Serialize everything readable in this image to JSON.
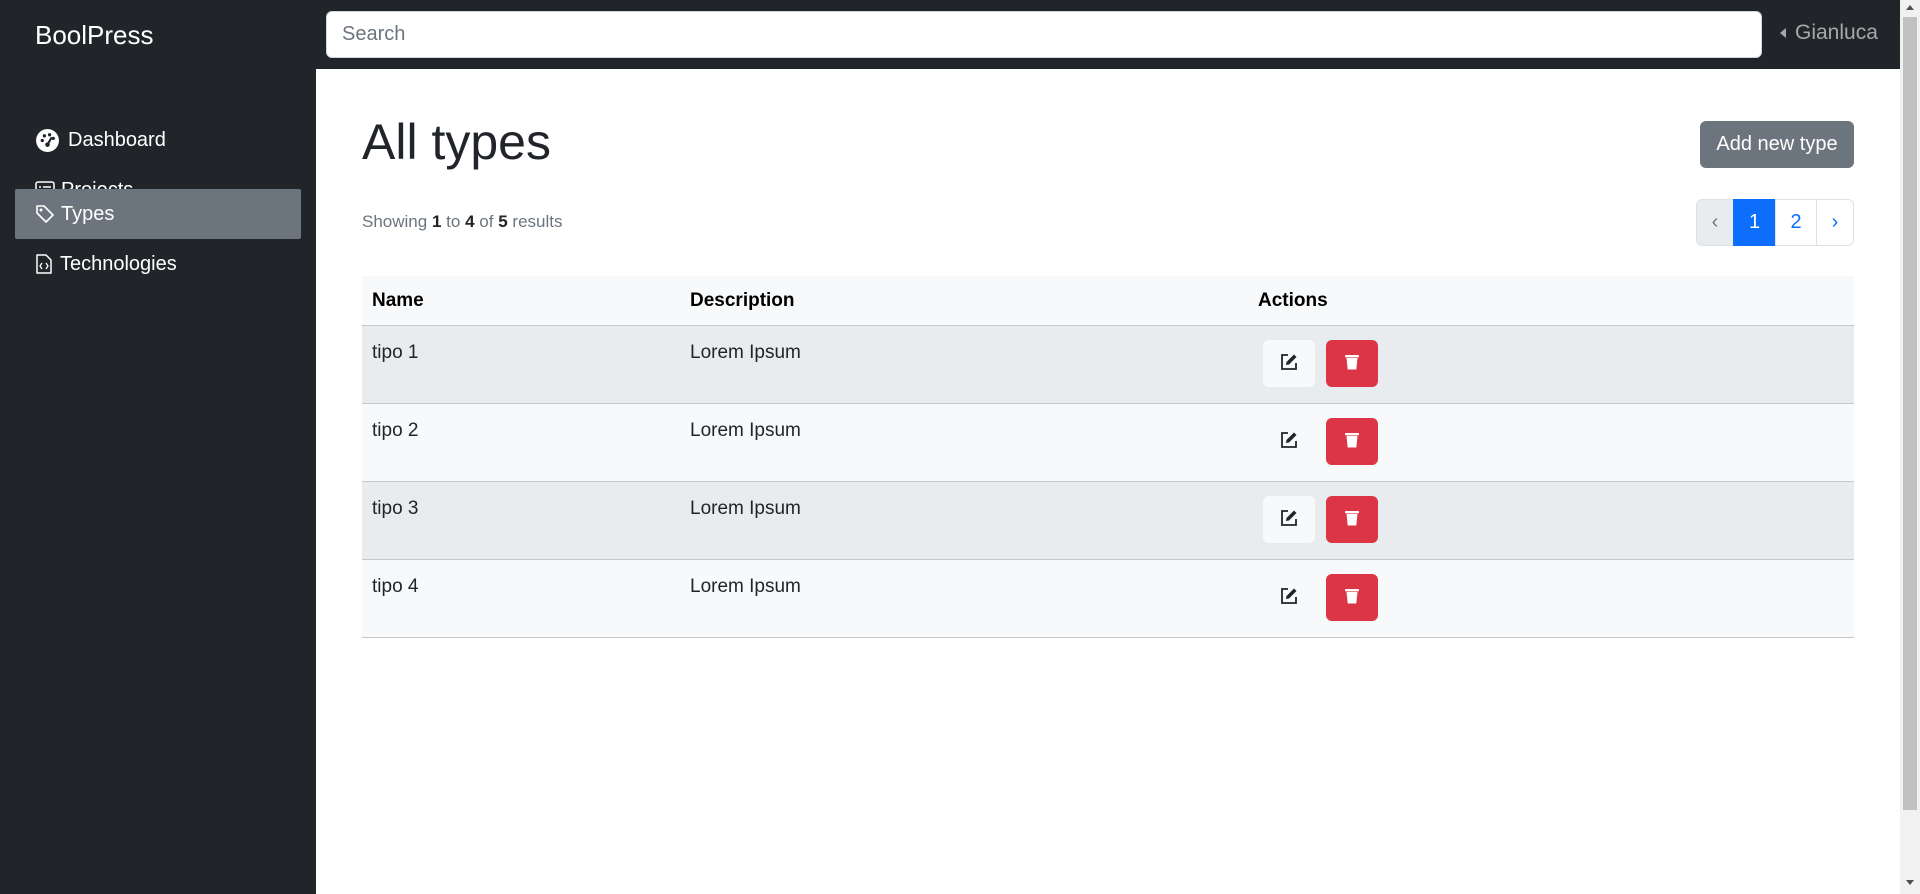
{
  "navbar": {
    "brand": "BoolPress",
    "search_placeholder": "Search",
    "user": "Gianluca"
  },
  "sidebar": {
    "items": [
      {
        "label": "Dashboard",
        "icon": "dashboard-icon",
        "active": false
      },
      {
        "label": "Projects",
        "icon": "list-icon",
        "active": false
      },
      {
        "label": "Types",
        "icon": "tag-icon",
        "active": true
      },
      {
        "label": "Technologies",
        "icon": "code-file-icon",
        "active": false
      }
    ]
  },
  "main": {
    "title": "All types",
    "add_button": "Add new type",
    "showing": {
      "prefix": "Showing",
      "from": "1",
      "to_word": "to",
      "to": "4",
      "of_word": "of",
      "total": "5",
      "suffix": "results"
    },
    "pagination": {
      "prev": "‹",
      "pages": [
        "1",
        "2"
      ],
      "current": "1",
      "next": "›"
    },
    "table": {
      "columns": [
        "Name",
        "Description",
        "Actions"
      ],
      "rows": [
        {
          "name": "tipo 1",
          "description": "Lorem Ipsum"
        },
        {
          "name": "tipo 2",
          "description": "Lorem Ipsum"
        },
        {
          "name": "tipo 3",
          "description": "Lorem Ipsum"
        },
        {
          "name": "tipo 4",
          "description": "Lorem Ipsum"
        }
      ]
    }
  },
  "colors": {
    "dark": "#212529",
    "secondary": "#6c757d",
    "primary": "#0d6efd",
    "danger": "#dc3545"
  }
}
